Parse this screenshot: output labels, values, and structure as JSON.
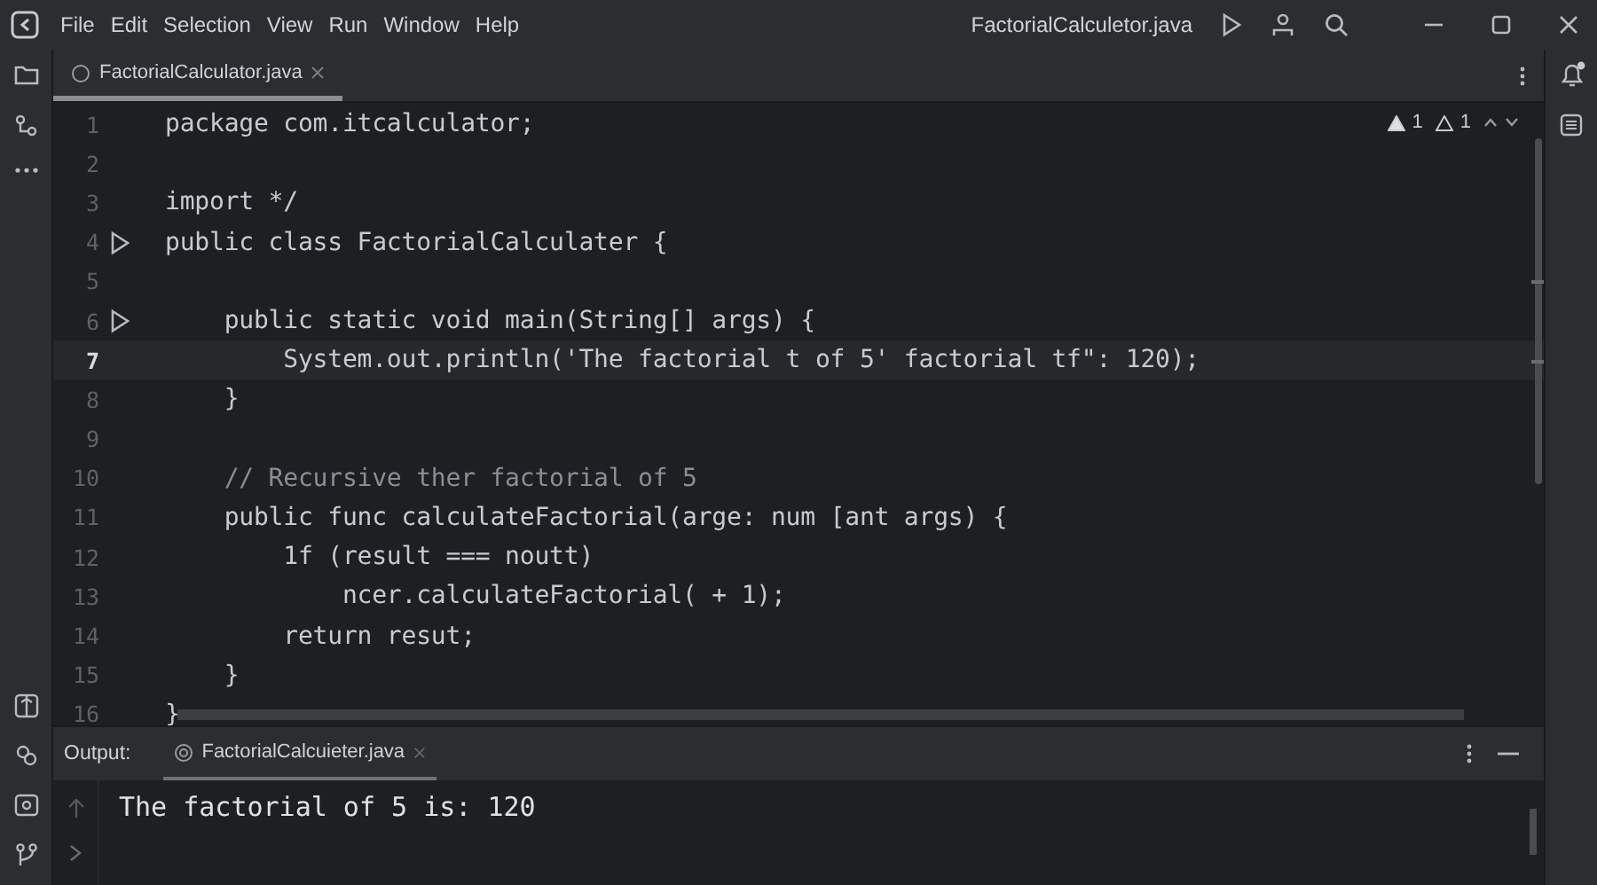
{
  "menu": [
    "File",
    "Edit",
    "Selection",
    "View",
    "Run",
    "Window",
    "Help"
  ],
  "window": {
    "title": "FactorialCalculetor.java"
  },
  "editor_tabs": [
    {
      "label": "FactorialCalculator.java",
      "selected": true
    }
  ],
  "inspections": [
    {
      "count": "1",
      "kind": "error"
    },
    {
      "count": "1",
      "kind": "warning"
    }
  ],
  "lines": [
    {
      "number": "1",
      "kind": "code",
      "text": "package com.itcalculator;",
      "run": false,
      "current": false
    },
    {
      "number": "2",
      "kind": "blank",
      "run": false,
      "current": false
    },
    {
      "number": "3",
      "kind": "code",
      "text": "import */",
      "run": false,
      "current": false
    },
    {
      "number": "4",
      "kind": "code",
      "text": "public class FactorialCalculater {",
      "run": true,
      "current": false
    },
    {
      "number": "5",
      "kind": "blank",
      "run": false,
      "current": false
    },
    {
      "number": "6",
      "kind": "code",
      "text": "    public static void main(String[] args) {",
      "run": true,
      "current": false
    },
    {
      "number": "7",
      "kind": "code",
      "text": "        System.out.println('The factorial t of 5' factorial tf\": 120);",
      "run": false,
      "current": true
    },
    {
      "number": "8",
      "kind": "code",
      "text": "    }",
      "run": false,
      "current": false
    },
    {
      "number": "9",
      "kind": "blank",
      "run": false,
      "current": false
    },
    {
      "number": "10",
      "kind": "comment",
      "text": "    // Recursive ther factorial of 5",
      "run": false,
      "current": false
    },
    {
      "number": "11",
      "kind": "code",
      "text": "    public func calculateFactorial(arge: num [ant args) {",
      "run": false,
      "current": false
    },
    {
      "number": "12",
      "kind": "code",
      "text": "        1f (result === noutt)",
      "run": false,
      "current": false
    },
    {
      "number": "13",
      "kind": "code",
      "text": "            ncer.calculateFactorial( + 1);",
      "run": false,
      "current": false
    },
    {
      "number": "14",
      "kind": "code",
      "text": "        return resut;",
      "run": false,
      "current": false
    },
    {
      "number": "15",
      "kind": "code",
      "text": "    }",
      "run": false,
      "current": false
    },
    {
      "number": "16",
      "kind": "code",
      "text": "}",
      "run": false,
      "current": false
    }
  ],
  "output": {
    "label": "Output:",
    "tabs": [
      {
        "label": "FactorialCalcuieter.java",
        "selected": true
      }
    ],
    "text": "The factorial of 5 is: 120"
  }
}
